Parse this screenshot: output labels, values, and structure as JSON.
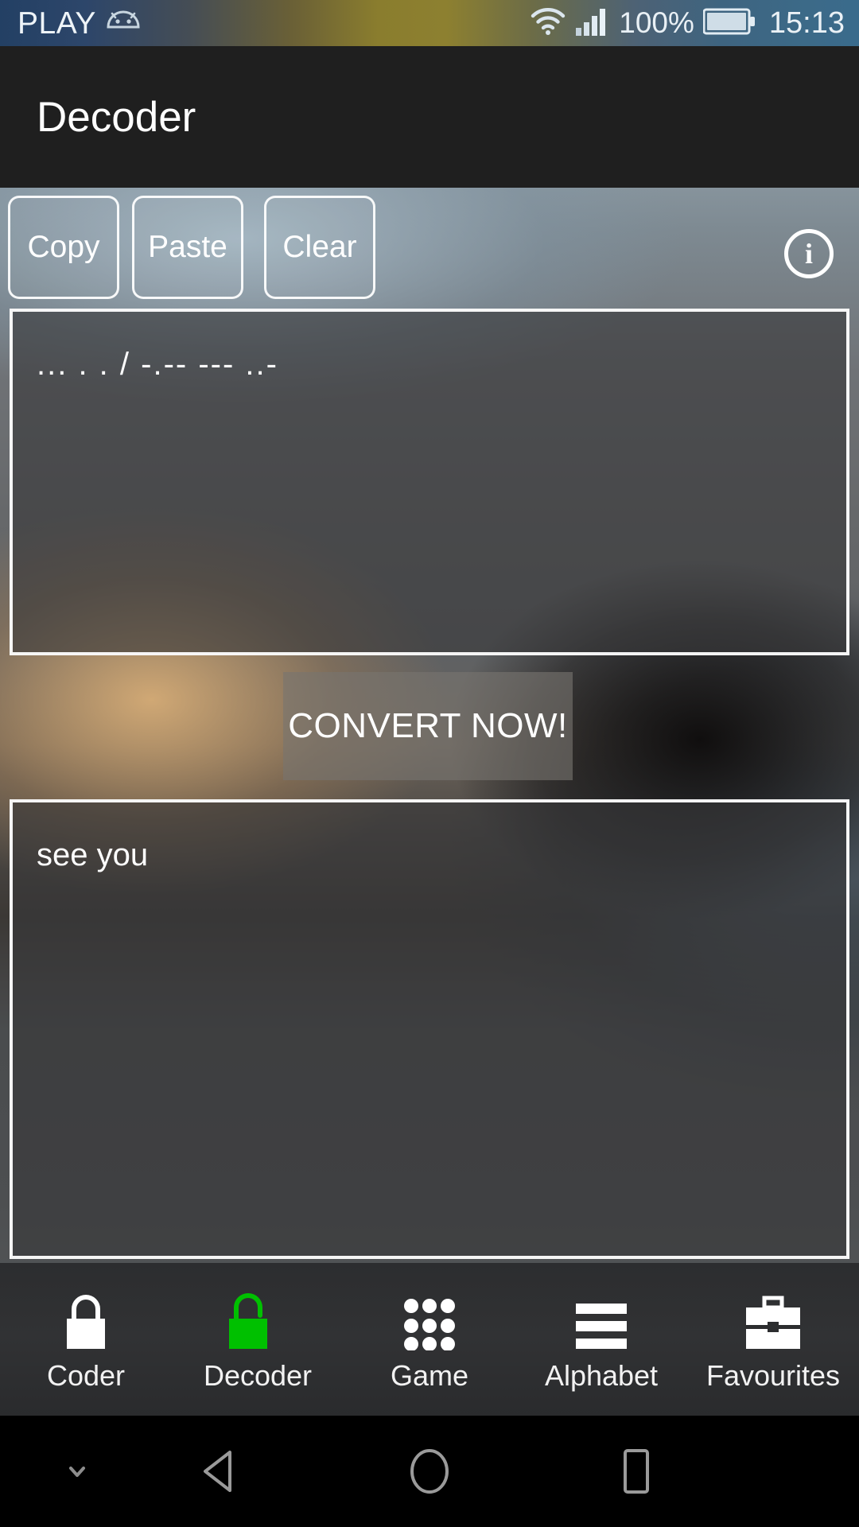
{
  "statusbar": {
    "carrier": "PLAY",
    "android_icon": "android-robot-icon",
    "wifi_icon": "wifi-icon",
    "signal_icon": "cellular-signal-icon",
    "battery_percent": "100%",
    "battery_icon": "battery-full-icon",
    "time": "15:13"
  },
  "header": {
    "title": "Decoder"
  },
  "toolbar": {
    "copy_label": "Copy",
    "paste_label": "Paste",
    "clear_label": "Clear",
    "info_label": "i",
    "info_icon": "info-circle-icon"
  },
  "input_field": {
    "value": "... . . / -.-- --- ..-",
    "placeholder": ""
  },
  "convert": {
    "label": "CONVERT NOW!"
  },
  "output_field": {
    "value": "see you",
    "placeholder": ""
  },
  "tabbar": {
    "items": [
      {
        "label": "Coder",
        "icon": "lock-closed-icon",
        "active": false,
        "color": "#ffffff"
      },
      {
        "label": "Decoder",
        "icon": "lock-open-icon",
        "active": true,
        "color": "#00c000"
      },
      {
        "label": "Game",
        "icon": "dot-grid-icon",
        "active": false,
        "color": "#ffffff"
      },
      {
        "label": "Alphabet",
        "icon": "list-lines-icon",
        "active": false,
        "color": "#ffffff"
      },
      {
        "label": "Favourites",
        "icon": "briefcase-icon",
        "active": false,
        "color": "#ffffff"
      }
    ]
  },
  "navbar": {
    "hide_icon": "chevron-down-icon",
    "back_icon": "back-triangle-icon",
    "home_icon": "home-circle-icon",
    "recent_icon": "recents-square-icon"
  },
  "colors": {
    "accent_green": "#00c000",
    "titlebar_bg": "#1f1f1f",
    "navbar_bg": "#000000"
  }
}
